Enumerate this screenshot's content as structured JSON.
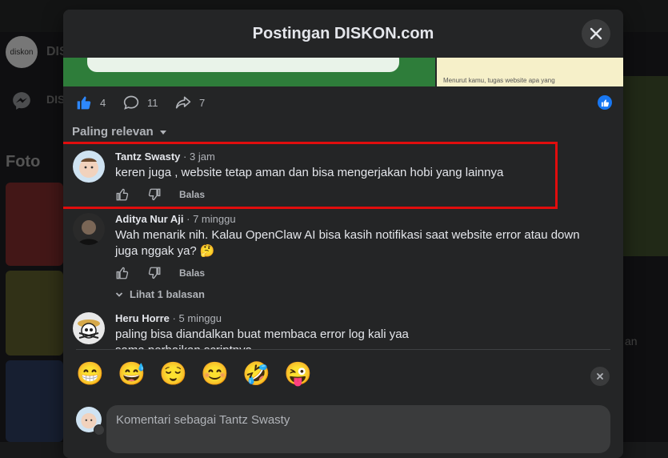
{
  "modal": {
    "title": "Postingan DISKON.com"
  },
  "background": {
    "page_logo": "diskon",
    "page_name": "DISK",
    "messenger_label": "DISK",
    "section_title": "Foto",
    "right_snippet": "an"
  },
  "post_image": {
    "caption": "Menurut kamu, tugas website apa yang"
  },
  "actions": {
    "likes": "4",
    "comments": "11",
    "shares": "7"
  },
  "sort": {
    "label": "Paling relevan"
  },
  "comments": [
    {
      "name": "Tantz Swasty",
      "sep": "·",
      "time": "3 jam",
      "text": "keren juga , website tetap aman dan bisa mengerjakan hobi yang lainnya",
      "reply": "Balas"
    },
    {
      "name": "Aditya Nur Aji",
      "sep": "·",
      "time": "7 minggu",
      "text": "Wah menarik nih. Kalau OpenClaw AI bisa kasih notifikasi saat website error atau down juga nggak ya? 🤔",
      "reply": "Balas",
      "more_replies": "Lihat 1 balasan"
    },
    {
      "name": "Heru Horre",
      "sep": "·",
      "time": "5 minggu",
      "text": "paling bisa diandalkan buat membaca error log kali yaa\nsama perbaikan scriptnya"
    }
  ],
  "emojis": [
    "😁",
    "😅",
    "😌",
    "😊",
    "🤣",
    "😜"
  ],
  "composer": {
    "placeholder": "Komentari sebagai Tantz Swasty"
  },
  "colors": {
    "accent": "#1877f2",
    "highlight": "#e10d0d",
    "surface": "#242526"
  }
}
